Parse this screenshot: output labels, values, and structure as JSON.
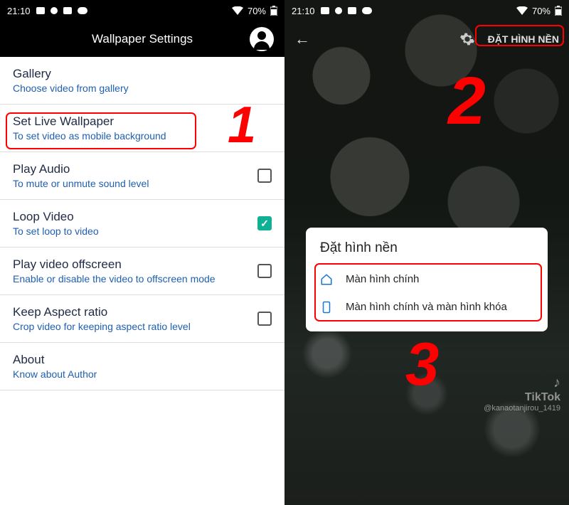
{
  "status": {
    "time": "21:10",
    "battery": "70%"
  },
  "left": {
    "header": {
      "title": "Wallpaper Settings"
    },
    "items": [
      {
        "title": "Gallery",
        "sub": "Choose video from gallery",
        "has_check": false
      },
      {
        "title": "Set Live Wallpaper",
        "sub": "To set video as mobile background",
        "has_check": false
      },
      {
        "title": "Play Audio",
        "sub": "To mute or unmute sound level",
        "has_check": true,
        "checked": false
      },
      {
        "title": "Loop Video",
        "sub": "To set loop to video",
        "has_check": true,
        "checked": true
      },
      {
        "title": "Play video offscreen",
        "sub": "Enable or disable the video to offscreen mode",
        "has_check": true,
        "checked": false
      },
      {
        "title": "Keep Aspect ratio",
        "sub": "Crop video for keeping aspect ratio level",
        "has_check": true,
        "checked": false
      },
      {
        "title": "About",
        "sub": "Know about Author",
        "has_check": false
      }
    ]
  },
  "right": {
    "set_label": "ĐẶT HÌNH NỀN",
    "dialog": {
      "title": "Đặt hình nền",
      "options": [
        {
          "icon": "home-icon",
          "label": "Màn hình chính"
        },
        {
          "icon": "phone-icon",
          "label": "Màn hình chính và màn hình khóa"
        }
      ]
    },
    "watermark": {
      "brand": "TikTok",
      "user": "@kanaotanjirou_1419"
    }
  },
  "annotations": {
    "n1": "1",
    "n2": "2",
    "n3": "3"
  }
}
